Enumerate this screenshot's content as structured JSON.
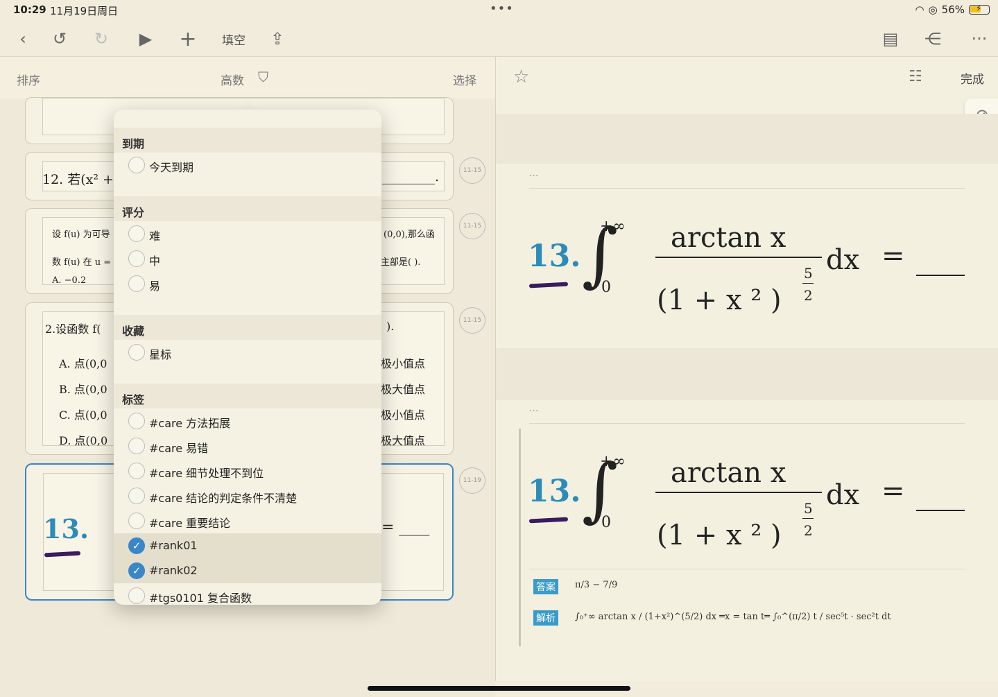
{
  "status": {
    "time": "10:29",
    "date": "11月19日周日",
    "battery": "56%"
  },
  "toolbar": {
    "fill_blank": "填空"
  },
  "left": {
    "sort_label": "排序",
    "title": "高数",
    "select_label": "选择",
    "cards": [
      {
        "badge": "",
        "lines": []
      },
      {
        "badge": "11-15",
        "lines": [
          "12. 若(x² +",
          "________."
        ]
      },
      {
        "badge": "11-15",
        "lines": [
          "设 f(u) 为可导",
          "(0,0),那么函",
          "数 f(u) 在 u =",
          "主部是(    ).",
          "A. −0.2"
        ]
      },
      {
        "badge": "11-15",
        "lines": [
          "2.设函数 f(",
          ").",
          "A. 点(0,0",
          "极小值点",
          "B. 点(0,0",
          "极大值点",
          "C. 点(0,0",
          "极小值点",
          "D. 点(0,0",
          "极大值点"
        ]
      },
      {
        "badge": "11-19",
        "lines": [
          "13.",
          "= ____"
        ]
      }
    ]
  },
  "filter_popover": {
    "sections": [
      {
        "title": "到期",
        "options": [
          {
            "label": "今天到期",
            "checked": false
          }
        ]
      },
      {
        "title": "评分",
        "options": [
          {
            "label": "难",
            "checked": false
          },
          {
            "label": "中",
            "checked": false
          },
          {
            "label": "易",
            "checked": false
          }
        ]
      },
      {
        "title": "收藏",
        "options": [
          {
            "label": "星标",
            "checked": false
          }
        ]
      },
      {
        "title": "标签",
        "options": [
          {
            "label": "#care 方法拓展",
            "checked": false
          },
          {
            "label": "#care 易错",
            "checked": false
          },
          {
            "label": "#care 细节处理不到位",
            "checked": false
          },
          {
            "label": "#care 结论的判定条件不清楚",
            "checked": false
          },
          {
            "label": "#care 重要结论",
            "checked": false
          },
          {
            "label": "#rank01",
            "checked": true
          },
          {
            "label": "#rank02",
            "checked": true
          },
          {
            "label": "#tgs0101 复合函数",
            "checked": false
          }
        ]
      }
    ]
  },
  "right": {
    "done_label": "完成",
    "ellipsis": "···",
    "formula": {
      "number": "13.",
      "upper": "+∞",
      "lower": "0",
      "numerator": "arctan x",
      "denominator": "(1 + x ² )",
      "exp_num": "5",
      "exp_den": "2",
      "dx": "dx",
      "eq": "="
    },
    "answer": {
      "answer_tag": "答案",
      "answer_value": "π/3 − 7/9",
      "analysis_tag": "解析",
      "analysis_text": "∫₀⁺∞ arctan x / (1+x²)^(5/2) dx  ═x = tan t═  ∫₀^(π/2) t / sec⁵t · sec²t dt"
    }
  }
}
